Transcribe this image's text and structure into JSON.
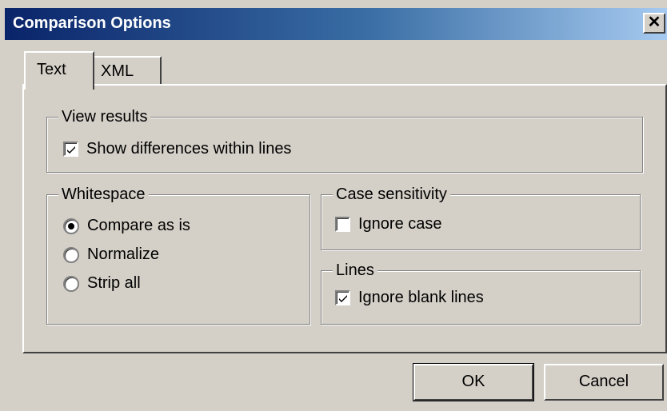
{
  "window": {
    "title": "Comparison Options",
    "close_glyph": "✕"
  },
  "tabs": [
    {
      "label": "Text",
      "selected": true
    },
    {
      "label": "XML",
      "selected": false
    }
  ],
  "view_results": {
    "legend": "View results",
    "show_differences": {
      "label": "Show differences within lines",
      "checked": true
    }
  },
  "whitespace": {
    "legend": "Whitespace",
    "options": [
      {
        "label": "Compare as is",
        "selected": true
      },
      {
        "label": "Normalize",
        "selected": false
      },
      {
        "label": "Strip all",
        "selected": false
      }
    ]
  },
  "case_sensitivity": {
    "legend": "Case sensitivity",
    "ignore_case": {
      "label": "Ignore case",
      "checked": false
    }
  },
  "lines": {
    "legend": "Lines",
    "ignore_blank_lines": {
      "label": "Ignore blank lines",
      "checked": true
    }
  },
  "buttons": {
    "ok": "OK",
    "cancel": "Cancel"
  }
}
